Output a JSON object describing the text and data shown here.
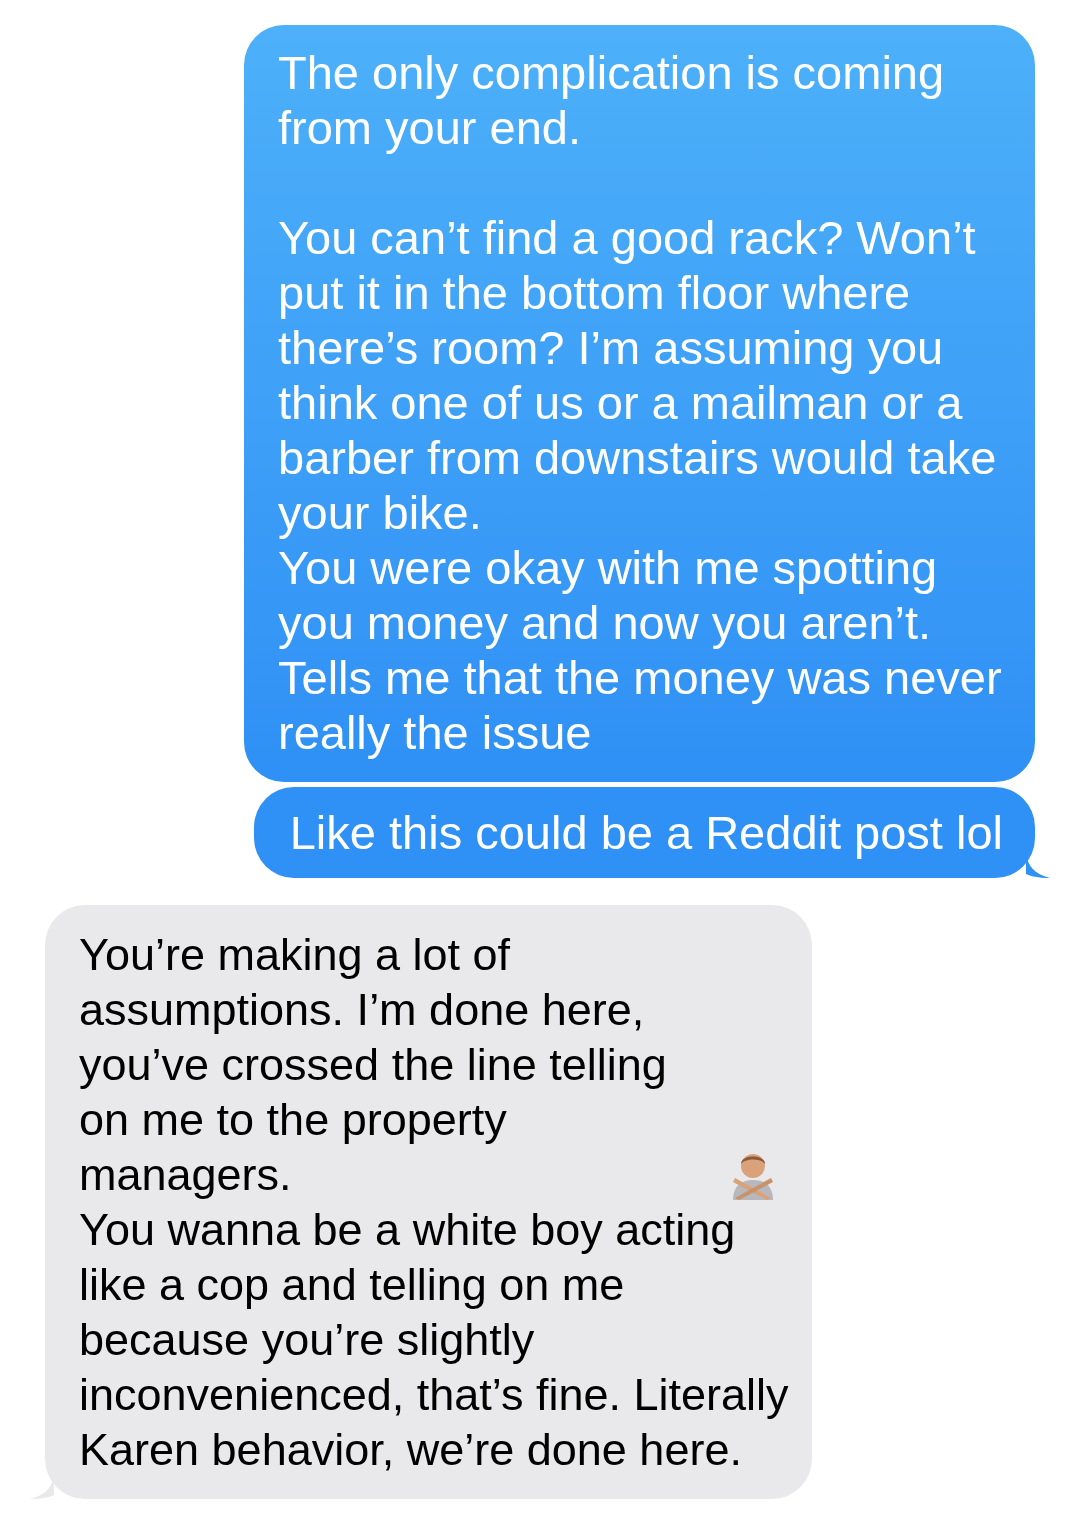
{
  "messages": [
    {
      "kind": "sent",
      "tail": false,
      "parts": [
        {
          "kind": "text",
          "text": "The only complication is coming from your end.\n\nYou can’t find a good rack? Won’t put it in the bottom floor where there’s room? I’m assuming you think one of us or a mailman or a barber from downstairs would take your bike.\nYou were okay with me spotting you money and now you aren’t. Tells me that the money was never really the issue"
        }
      ]
    },
    {
      "kind": "sent",
      "tail": true,
      "parts": [
        {
          "kind": "text",
          "text": "Like this could be a Reddit post lol"
        }
      ]
    },
    {
      "kind": "received",
      "tail": true,
      "parts": [
        {
          "kind": "text",
          "text": "You’re making a lot of assumptions. I’m done here, you’ve crossed the line telling on me to the property managers."
        },
        {
          "kind": "emoji"
        },
        {
          "kind": "text",
          "text": "You wanna be a white boy acting like a cop and telling on me because you’re slightly inconvenienced, that’s fine. Literally Karen behavior, we’re done here."
        }
      ]
    }
  ]
}
